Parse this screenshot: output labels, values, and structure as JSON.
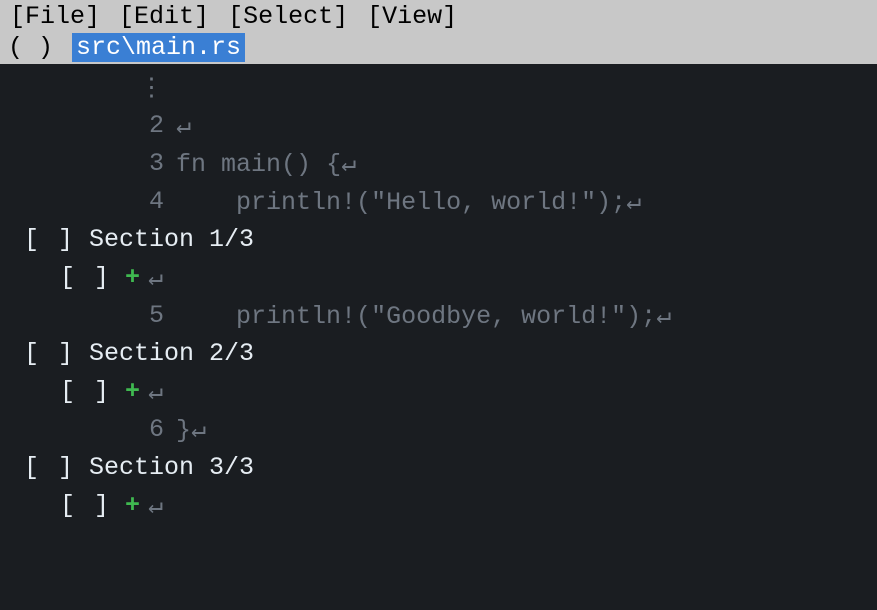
{
  "menu": {
    "file": "[File]",
    "edit": "[Edit]",
    "select": "[Select]",
    "view": "[View]"
  },
  "tab": {
    "close": "( )",
    "title": "src\\main.rs"
  },
  "glyphs": {
    "ellipsis": "⋮",
    "newline": "↵",
    "plus": "+"
  },
  "lines": {
    "l2_num": "2",
    "l3_num": "3",
    "l3_fn": "fn",
    "l3_name": "main",
    "l3_parens": "()",
    "l3_brace": " {",
    "l4_num": "4",
    "l4_indent": "    ",
    "l4_macro": "println!",
    "l4_open": "(",
    "l4_str": "\"Hello, world!\"",
    "l4_close": ");",
    "l5_num": "5",
    "l5_indent": "    ",
    "l5_macro": "println!",
    "l5_open": "(",
    "l5_str": "\"Goodbye, world!\"",
    "l5_close": ");",
    "l6_num": "6",
    "l6_brace": "}"
  },
  "sections": {
    "cb": "[ ]",
    "s1": "Section 1/3",
    "s2": "Section 2/3",
    "s3": "Section 3/3"
  }
}
